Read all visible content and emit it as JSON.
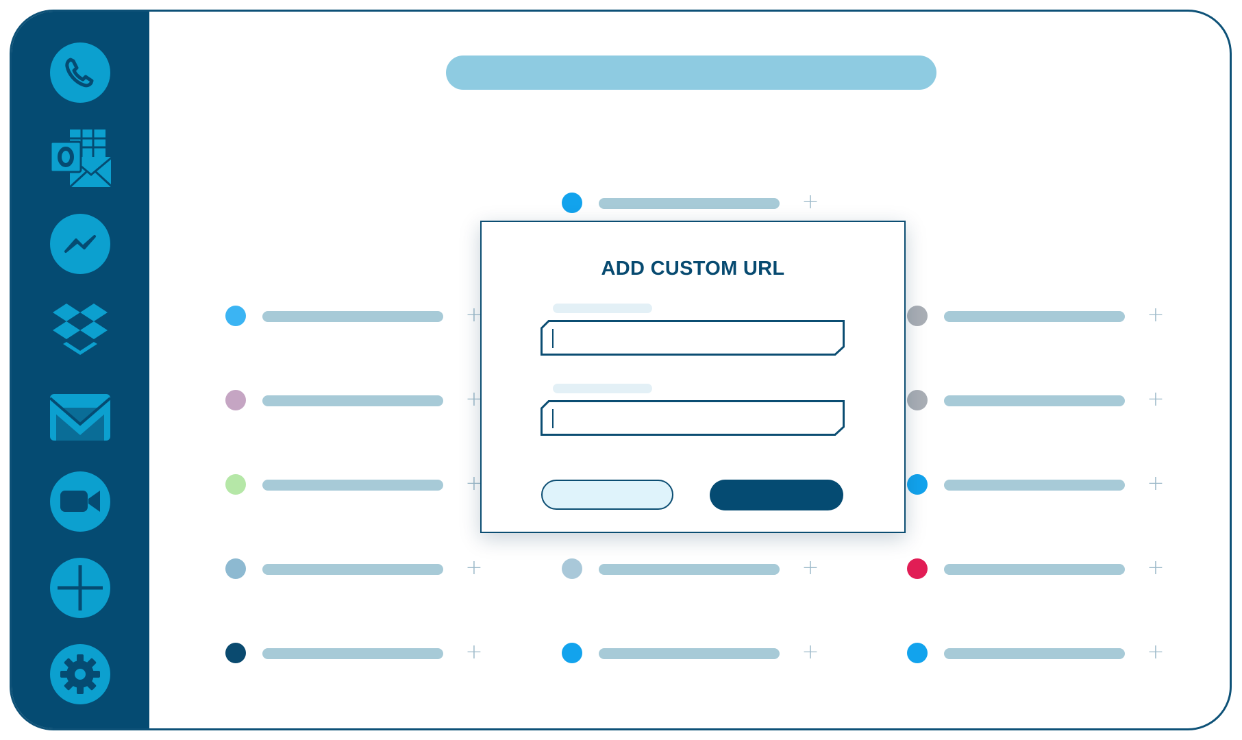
{
  "modal": {
    "title": "ADD CUSTOM URL"
  },
  "sidebar": {
    "items": [
      {
        "icon": "phone-icon"
      },
      {
        "icon": "outlook-icon"
      },
      {
        "icon": "messenger-icon"
      },
      {
        "icon": "dropbox-icon"
      },
      {
        "icon": "mail-icon"
      },
      {
        "icon": "video-camera-icon"
      },
      {
        "icon": "plus-icon"
      },
      {
        "icon": "gear-icon"
      }
    ]
  },
  "cards": [
    {
      "dot": "#12a3ed"
    },
    {
      "dot": "#3bb4f3"
    },
    {
      "dot": "#a9aeb5"
    },
    {
      "dot": "#c5a5c3"
    },
    {
      "dot": "#a9aeb5"
    },
    {
      "dot": "#b5e7a7"
    },
    {
      "dot": "#12a3ed"
    },
    {
      "dot": "#8db9d1"
    },
    {
      "dot": "#a9c8d9"
    },
    {
      "dot": "#e11d55"
    },
    {
      "dot": "#0a4a6f"
    },
    {
      "dot": "#12a3ed"
    },
    {
      "dot": "#12a3ed"
    }
  ],
  "colors": {
    "sidebar": "#054b72",
    "icon": "#0ca0cf",
    "accent": "#054b72",
    "placeholder_bar": "#a7cad7",
    "header_bar": "#8ecbe1"
  }
}
